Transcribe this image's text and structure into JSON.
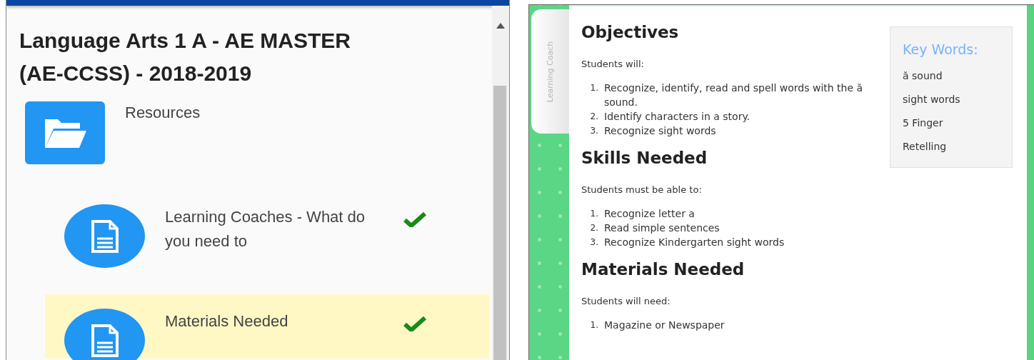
{
  "course": {
    "title": "Language Arts 1 A - AE MASTER (AE-CCSS) - 2018-2019",
    "folder": {
      "label": "Resources",
      "children": [
        {
          "label": "Learning Coaches - What do you need to",
          "completed": true,
          "selected": false
        },
        {
          "label": "Materials Needed",
          "completed": true,
          "selected": true
        }
      ]
    }
  },
  "side_tab": {
    "label": "Learning Coach"
  },
  "lesson": {
    "sections": [
      {
        "heading": "Objectives",
        "intro": "Students will:",
        "items": [
          {
            "number": "1.",
            "text": "Recognize, identify, read and spell words with the ă sound."
          },
          {
            "number": "2.",
            "text": "Identify characters in a story."
          },
          {
            "number": "3.",
            "text": "Recognize sight words"
          }
        ]
      },
      {
        "heading": "Skills Needed",
        "intro": "Students must be able to:",
        "items": [
          {
            "number": "1.",
            "text": "Recognize letter a"
          },
          {
            "number": "2.",
            "text": "Read simple sentences"
          },
          {
            "number": "3.",
            "text": "Recognize Kindergarten sight words"
          }
        ]
      },
      {
        "heading": "Materials Needed",
        "intro": "Students will need:",
        "items": [
          {
            "number": "1.",
            "text": "Magazine or Newspaper"
          }
        ]
      }
    ],
    "key_words": {
      "title": "Key Words:",
      "words": [
        "ă sound",
        "sight words",
        "5 Finger",
        "Retelling"
      ]
    }
  }
}
